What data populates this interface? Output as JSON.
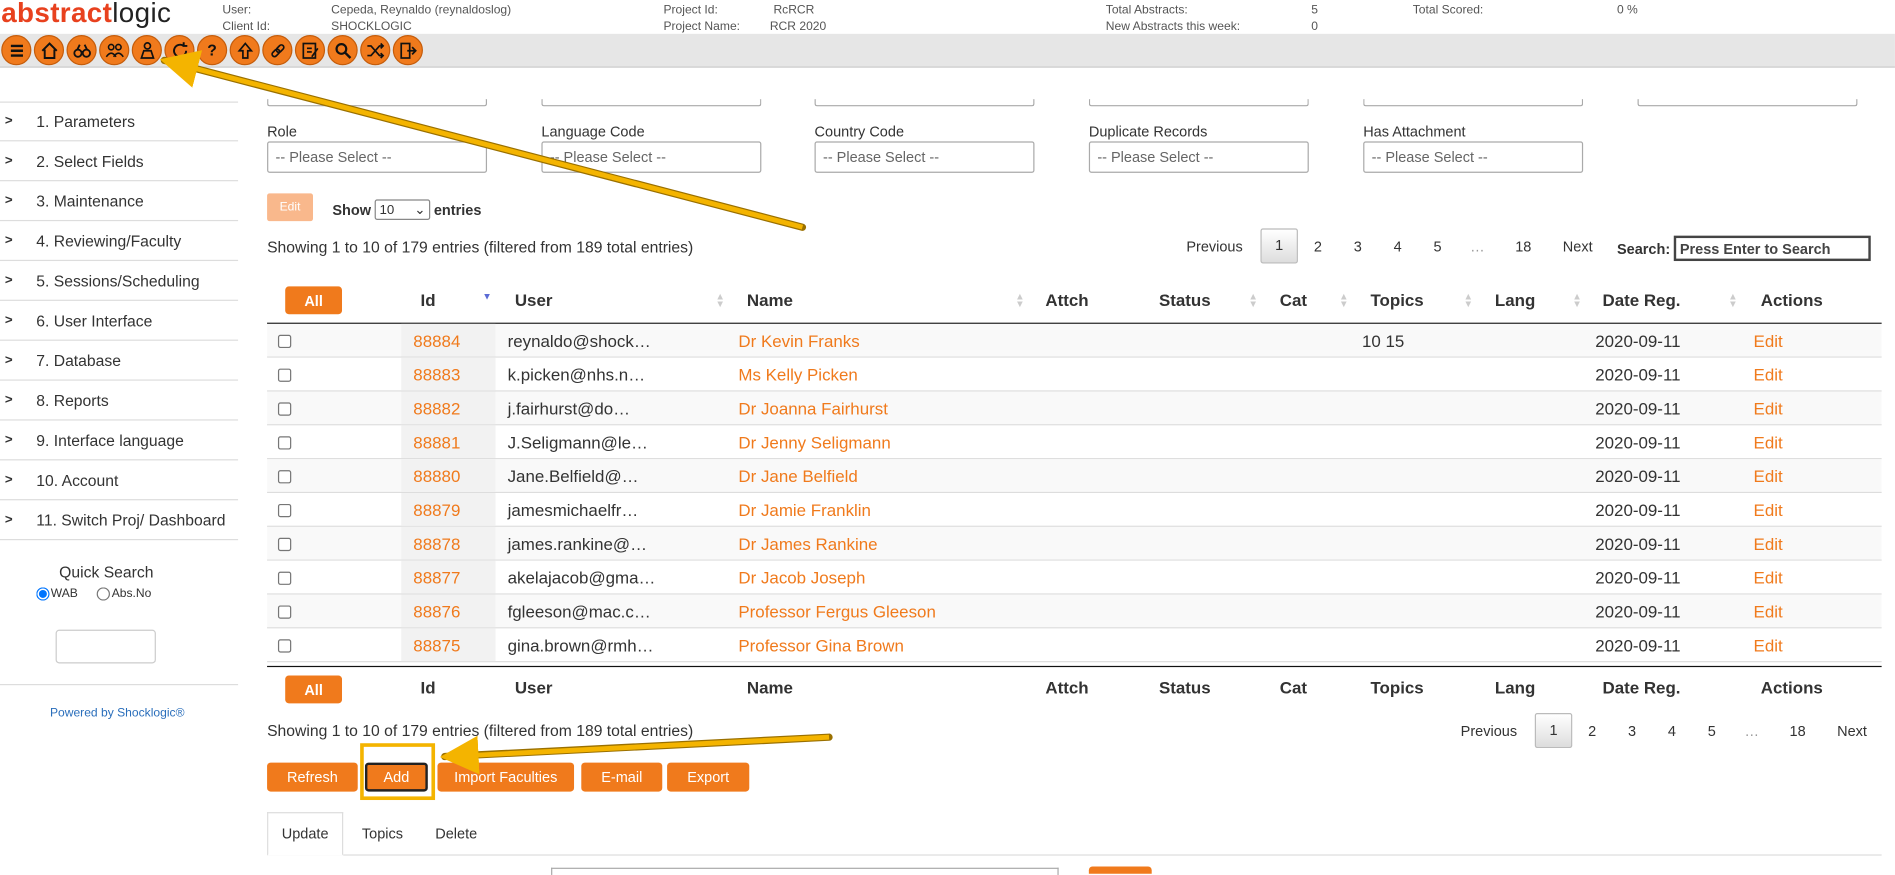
{
  "app": {
    "logo_part1": "abstract",
    "logo_part2": "logic"
  },
  "topinfo": {
    "user_label": "User:",
    "user_value": "Cepeda, Reynaldo (reynaldoslog)",
    "client_label": "Client Id:",
    "client_value": "SHOCKLOGIC",
    "project_id_label": "Project Id:",
    "project_id_value": "RcRCR",
    "project_name_label": "Project Name:",
    "project_name_value": "RCR 2020",
    "total_abstracts_label": "Total Abstracts:",
    "total_abstracts_value": "5",
    "new_abstracts_label": "New Abstracts this week:",
    "new_abstracts_value": "0",
    "total_scored_label": "Total Scored:",
    "total_scored_value": "0 %"
  },
  "toolbar": [
    "menu-icon",
    "home-icon",
    "binoculars-icon",
    "users-icon",
    "faculty-icon",
    "refresh-icon",
    "help-icon",
    "upload-icon",
    "link-icon",
    "edit-icon",
    "search-icon",
    "shuffle-icon",
    "logout-icon"
  ],
  "sidebar": {
    "items": [
      {
        "label": "1. Parameters"
      },
      {
        "label": "2. Select Fields"
      },
      {
        "label": "3. Maintenance"
      },
      {
        "label": "4. Reviewing/Faculty"
      },
      {
        "label": "5. Sessions/Scheduling"
      },
      {
        "label": "6. User Interface"
      },
      {
        "label": "7. Database"
      },
      {
        "label": "8. Reports"
      },
      {
        "label": "9. Interface language"
      },
      {
        "label": "10. Account"
      },
      {
        "label": "11. Switch Proj/ Dashboard"
      }
    ],
    "quick_search": "Quick Search",
    "radio_wab": "WAB",
    "radio_absno": "Abs.No",
    "powered": "Powered by Shocklogic®"
  },
  "filters": {
    "role_label": "Role",
    "language_label": "Language Code",
    "country_label": "Country Code",
    "duplicate_label": "Duplicate Records",
    "attachment_label": "Has Attachment",
    "placeholder": "-- Please Select --"
  },
  "controls": {
    "edit": "Edit",
    "show": "Show",
    "show_value": "10",
    "entries": "entries",
    "info": "Showing 1 to 10 of 179 entries (filtered from 189 total entries)",
    "search_label": "Search:",
    "search_placeholder": "Press Enter to Search"
  },
  "pager": {
    "previous": "Previous",
    "pages": [
      "1",
      "2",
      "3",
      "4",
      "5",
      "…",
      "18"
    ],
    "next": "Next"
  },
  "table": {
    "all_label": "All",
    "headers": {
      "id": "Id",
      "user": "User",
      "name": "Name",
      "attch": "Attch",
      "status": "Status",
      "cat": "Cat",
      "topics": "Topics",
      "lang": "Lang",
      "date": "Date Reg.",
      "actions": "Actions"
    },
    "rows": [
      {
        "id": "88884",
        "user": "reynaldo@shock…",
        "name": "Dr Kevin Franks",
        "topics": "10 15",
        "date": "2020-09-11",
        "action": "Edit"
      },
      {
        "id": "88883",
        "user": "k.picken@nhs.n…",
        "name": "Ms Kelly Picken",
        "topics": "",
        "date": "2020-09-11",
        "action": "Edit"
      },
      {
        "id": "88882",
        "user": "j.fairhurst@do…",
        "name": "Dr Joanna Fairhurst",
        "topics": "",
        "date": "2020-09-11",
        "action": "Edit"
      },
      {
        "id": "88881",
        "user": "J.Seligmann@le…",
        "name": "Dr Jenny Seligmann",
        "topics": "",
        "date": "2020-09-11",
        "action": "Edit"
      },
      {
        "id": "88880",
        "user": "Jane.Belfield@…",
        "name": "Dr Jane Belfield",
        "topics": "",
        "date": "2020-09-11",
        "action": "Edit"
      },
      {
        "id": "88879",
        "user": "jamesmichaelfr…",
        "name": "Dr Jamie Franklin",
        "topics": "",
        "date": "2020-09-11",
        "action": "Edit"
      },
      {
        "id": "88878",
        "user": "james.rankine@…",
        "name": "Dr James Rankine",
        "topics": "",
        "date": "2020-09-11",
        "action": "Edit"
      },
      {
        "id": "88877",
        "user": "akelajacob@gma…",
        "name": "Dr Jacob Joseph",
        "topics": "",
        "date": "2020-09-11",
        "action": "Edit"
      },
      {
        "id": "88876",
        "user": "fgleeson@mac.c…",
        "name": "Professor Fergus Gleeson",
        "topics": "",
        "date": "2020-09-11",
        "action": "Edit"
      },
      {
        "id": "88875",
        "user": "gina.brown@rmh…",
        "name": "Professor Gina Brown",
        "topics": "",
        "date": "2020-09-11",
        "action": "Edit"
      }
    ]
  },
  "actions": {
    "refresh": "Refresh",
    "add": "Add",
    "import": "Import Faculties",
    "email": "E-mail",
    "export": "Export"
  },
  "tabs": [
    "Update",
    "Topics",
    "Delete"
  ],
  "colors": {
    "accent": "#f07a1c",
    "annotation": "#f4b400"
  }
}
